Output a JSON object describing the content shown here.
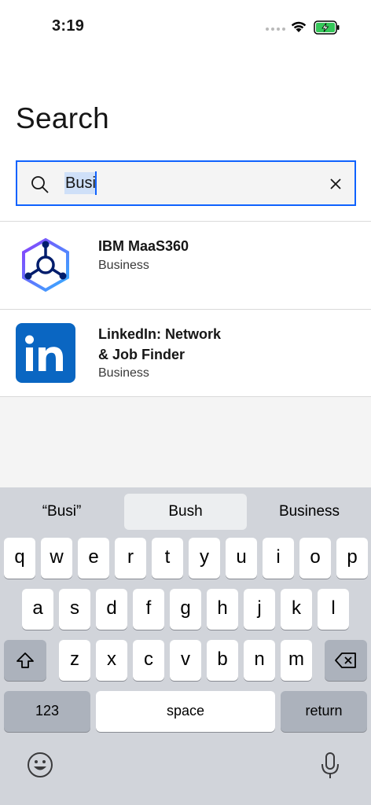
{
  "status_bar": {
    "time": "3:19"
  },
  "page": {
    "title": "Search"
  },
  "search": {
    "value": "Busi"
  },
  "results": [
    {
      "name_line1": "IBM MaaS360",
      "name_line2": "",
      "category": "Business",
      "icon": "maas360-logo-icon"
    },
    {
      "name_line1": "LinkedIn: Network",
      "name_line2": "& Job Finder",
      "category": "Business",
      "icon": "linkedin-logo-icon"
    }
  ],
  "keyboard": {
    "suggestions": [
      "“Busi”",
      "Bush",
      "Business"
    ],
    "row1": [
      "q",
      "w",
      "e",
      "r",
      "t",
      "y",
      "u",
      "i",
      "o",
      "p"
    ],
    "row2": [
      "a",
      "s",
      "d",
      "f",
      "g",
      "h",
      "j",
      "k",
      "l"
    ],
    "row3": [
      "z",
      "x",
      "c",
      "v",
      "b",
      "n",
      "m"
    ],
    "numbers_label": "123",
    "space_label": "space",
    "return_label": "return"
  },
  "colors": {
    "accent": "#0f62fe",
    "linkedin_blue": "#0a66c2"
  }
}
